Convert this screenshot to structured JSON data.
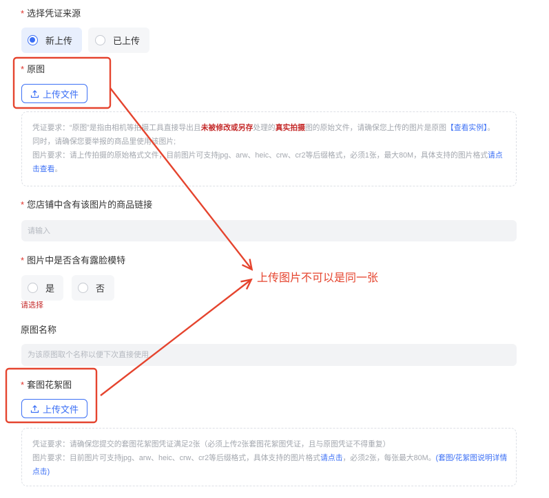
{
  "colors": {
    "accent": "#3b6ff5",
    "required": "#e0332b",
    "error": "#c42a2a",
    "annotation": "#e5442e"
  },
  "source": {
    "required_mark": "*",
    "label": "选择凭证来源",
    "options": [
      {
        "label": "新上传",
        "selected": true
      },
      {
        "label": "已上传",
        "selected": false
      }
    ]
  },
  "original": {
    "required_mark": "*",
    "label": "原图",
    "upload_icon": "upload-icon",
    "upload_label": "上传文件",
    "notice": {
      "line1": [
        "凭证要求：“原图”是指由相机等拍摄工具直接导出且",
        "未被修改或另存",
        "处理的",
        "真实拍摄",
        "图的原始文件，请确保您上传的图片是原图",
        "【查看实例】",
        "。"
      ],
      "line2": "同时，请确保您要举报的商品里使用该图片;",
      "line3": [
        "图片要求：请上传拍摄的原始格式文件，目前图片可支持jpg、arw、heic、crw、cr2等后缀格式，必须1张，最大80M，具体支持的图片格式",
        "请点击查看",
        "。"
      ]
    }
  },
  "product_link": {
    "required_mark": "*",
    "label": "您店铺中含有该图片的商品链接",
    "placeholder": "请输入"
  },
  "face_model": {
    "required_mark": "*",
    "label": "图片中是否含有露脸模特",
    "options": [
      {
        "label": "是",
        "selected": false
      },
      {
        "label": "否",
        "selected": false
      }
    ],
    "error": "请选择"
  },
  "original_name": {
    "label": "原图名称",
    "placeholder": "为该原图取个名称以便下次直接使用"
  },
  "flower": {
    "required_mark": "*",
    "label": "套图花絮图",
    "upload_icon": "upload-icon",
    "upload_label": "上传文件",
    "notice": {
      "line1": "凭证要求：请确保您提交的套图花絮图凭证满足2张（必须上传2张套图花絮图凭证，且与原图凭证不得重复）",
      "line2": [
        "图片要求：目前图片可支持jpg、arw、heic、crw、cr2等后缀格式，具体支持的图片格式",
        "请点击",
        "，必须2张，每张最大80M。",
        "(套图/花絮图说明详情点击)"
      ]
    }
  },
  "annotation": {
    "text": "上传图片不可以是同一张"
  }
}
